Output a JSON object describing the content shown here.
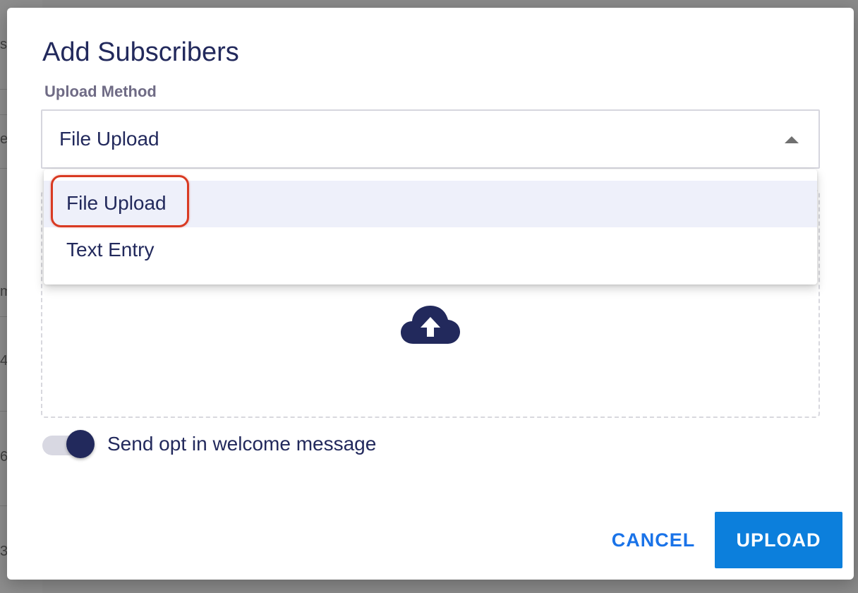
{
  "background": {
    "edge_chars": [
      "s",
      "e",
      "m",
      "4",
      "6",
      "3"
    ]
  },
  "dialog": {
    "title": "Add Subscribers",
    "upload_method": {
      "label": "Upload Method",
      "value": "File Upload",
      "options": [
        "File Upload",
        "Text Entry"
      ],
      "selected_index": 0
    },
    "dropzone": {
      "icon": "cloud-upload-icon"
    },
    "opt_in_toggle": {
      "label": "Send opt in welcome message",
      "on": true
    },
    "buttons": {
      "cancel": "CANCEL",
      "upload": "UPLOAD"
    }
  },
  "colors": {
    "primary_navy": "#22295c",
    "accent_blue": "#0c7fdc",
    "link_blue": "#1a73e8",
    "highlight_red": "#d93a22"
  }
}
